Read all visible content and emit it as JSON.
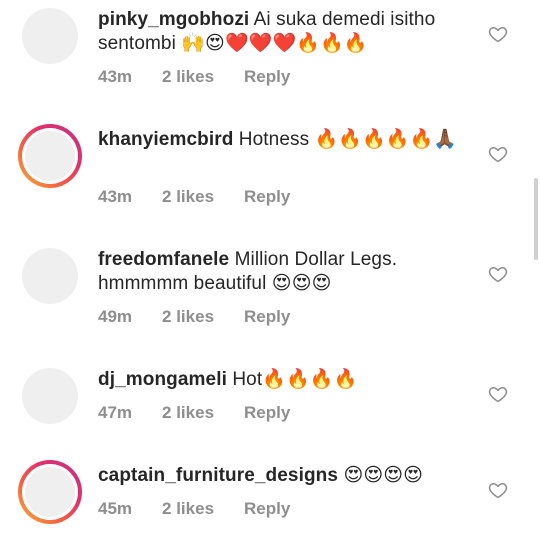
{
  "comments": [
    {
      "username": "pinky_mgobhozi",
      "text": " Ai suka demedi isitho sentombi 🙌😍❤️❤️❤️🔥🔥🔥",
      "time": "43m",
      "likes": "2 likes",
      "reply": "Reply",
      "story": false
    },
    {
      "username": "khanyiemcbird",
      "text": " Hotness 🔥🔥🔥🔥🔥🙏🏾",
      "time": "43m",
      "likes": "2 likes",
      "reply": "Reply",
      "story": true
    },
    {
      "username": "freedomfanele",
      "text": " Million Dollar Legs. hmmmmm beautiful 😍😍😍",
      "time": "49m",
      "likes": "2 likes",
      "reply": "Reply",
      "story": false
    },
    {
      "username": "dj_mongameli",
      "text": " Hot🔥🔥🔥🔥",
      "time": "47m",
      "likes": "2 likes",
      "reply": "Reply",
      "story": false
    },
    {
      "username": "captain_furniture_designs",
      "text": " 😍😍😍😍",
      "time": "45m",
      "likes": "2 likes",
      "reply": "Reply",
      "story": true
    }
  ],
  "icons": {
    "like": "heart-outline-icon"
  },
  "colors": {
    "text": "#262626",
    "meta": "#8e8e8e",
    "avatar_placeholder": "#efefef",
    "story_ring": [
      "#f9b03a",
      "#f56040",
      "#e1306c",
      "#c13584"
    ]
  }
}
